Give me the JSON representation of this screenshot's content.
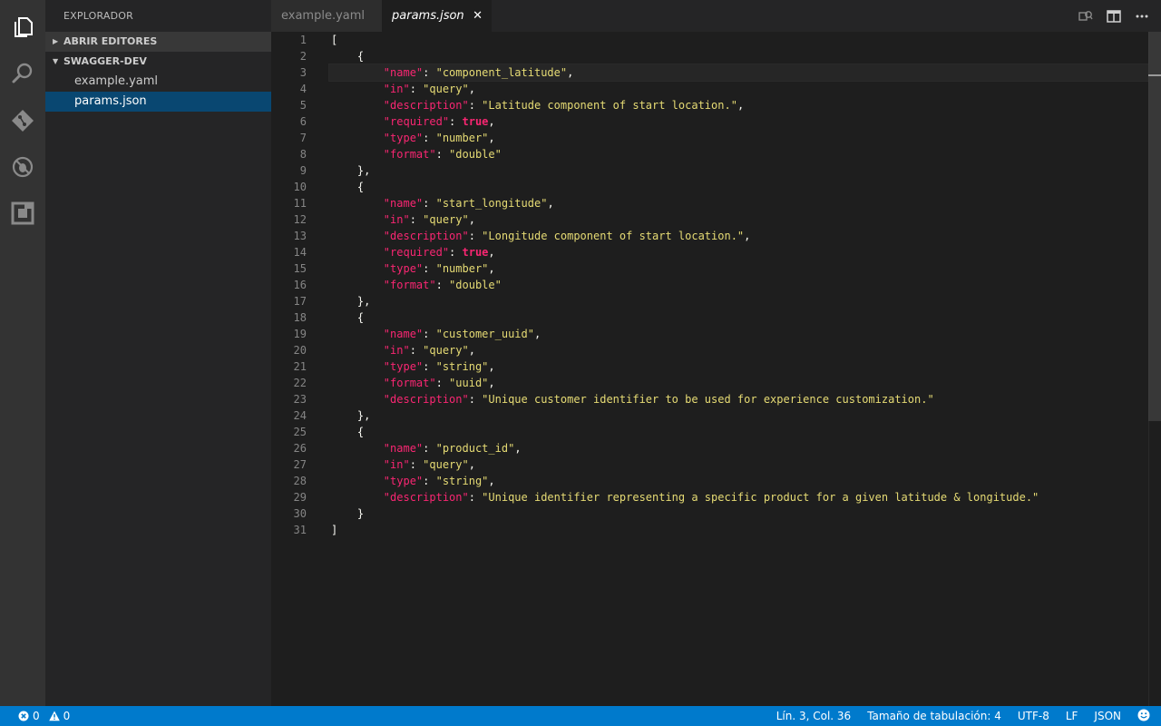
{
  "explorer": {
    "title": "EXPLORADOR",
    "open_editors": "ABRIR EDITORES",
    "project": "SWAGGER-DEV",
    "files": [
      "example.yaml",
      "params.json"
    ]
  },
  "tabs": [
    {
      "label": "example.yaml"
    },
    {
      "label": "params.json",
      "close": "✕"
    }
  ],
  "editor": {
    "line_numbers": [
      "1",
      "2",
      "3",
      "4",
      "5",
      "6",
      "7",
      "8",
      "9",
      "10",
      "11",
      "12",
      "13",
      "14",
      "15",
      "16",
      "17",
      "18",
      "19",
      "20",
      "21",
      "22",
      "23",
      "24",
      "25",
      "26",
      "27",
      "28",
      "29",
      "30",
      "31"
    ],
    "tokens": [
      [
        [
          "p",
          "["
        ]
      ],
      [
        [
          "p",
          "    {"
        ]
      ],
      [
        [
          "p",
          "        "
        ],
        [
          "k",
          "\"name\""
        ],
        [
          "p",
          ": "
        ],
        [
          "s",
          "\"component_latitude\""
        ],
        [
          "p",
          ","
        ]
      ],
      [
        [
          "p",
          "        "
        ],
        [
          "k",
          "\"in\""
        ],
        [
          "p",
          ": "
        ],
        [
          "s",
          "\"query\""
        ],
        [
          "p",
          ","
        ]
      ],
      [
        [
          "p",
          "        "
        ],
        [
          "k",
          "\"description\""
        ],
        [
          "p",
          ": "
        ],
        [
          "s",
          "\"Latitude component of start location.\""
        ],
        [
          "p",
          ","
        ]
      ],
      [
        [
          "p",
          "        "
        ],
        [
          "k",
          "\"required\""
        ],
        [
          "p",
          ": "
        ],
        [
          "b",
          "true"
        ],
        [
          "p",
          ","
        ]
      ],
      [
        [
          "p",
          "        "
        ],
        [
          "k",
          "\"type\""
        ],
        [
          "p",
          ": "
        ],
        [
          "s",
          "\"number\""
        ],
        [
          "p",
          ","
        ]
      ],
      [
        [
          "p",
          "        "
        ],
        [
          "k",
          "\"format\""
        ],
        [
          "p",
          ": "
        ],
        [
          "s",
          "\"double\""
        ]
      ],
      [
        [
          "p",
          "    },"
        ]
      ],
      [
        [
          "p",
          "    {"
        ]
      ],
      [
        [
          "p",
          "        "
        ],
        [
          "k",
          "\"name\""
        ],
        [
          "p",
          ": "
        ],
        [
          "s",
          "\"start_longitude\""
        ],
        [
          "p",
          ","
        ]
      ],
      [
        [
          "p",
          "        "
        ],
        [
          "k",
          "\"in\""
        ],
        [
          "p",
          ": "
        ],
        [
          "s",
          "\"query\""
        ],
        [
          "p",
          ","
        ]
      ],
      [
        [
          "p",
          "        "
        ],
        [
          "k",
          "\"description\""
        ],
        [
          "p",
          ": "
        ],
        [
          "s",
          "\"Longitude component of start location.\""
        ],
        [
          "p",
          ","
        ]
      ],
      [
        [
          "p",
          "        "
        ],
        [
          "k",
          "\"required\""
        ],
        [
          "p",
          ": "
        ],
        [
          "b",
          "true"
        ],
        [
          "p",
          ","
        ]
      ],
      [
        [
          "p",
          "        "
        ],
        [
          "k",
          "\"type\""
        ],
        [
          "p",
          ": "
        ],
        [
          "s",
          "\"number\""
        ],
        [
          "p",
          ","
        ]
      ],
      [
        [
          "p",
          "        "
        ],
        [
          "k",
          "\"format\""
        ],
        [
          "p",
          ": "
        ],
        [
          "s",
          "\"double\""
        ]
      ],
      [
        [
          "p",
          "    },"
        ]
      ],
      [
        [
          "p",
          "    {"
        ]
      ],
      [
        [
          "p",
          "        "
        ],
        [
          "k",
          "\"name\""
        ],
        [
          "p",
          ": "
        ],
        [
          "s",
          "\"customer_uuid\""
        ],
        [
          "p",
          ","
        ]
      ],
      [
        [
          "p",
          "        "
        ],
        [
          "k",
          "\"in\""
        ],
        [
          "p",
          ": "
        ],
        [
          "s",
          "\"query\""
        ],
        [
          "p",
          ","
        ]
      ],
      [
        [
          "p",
          "        "
        ],
        [
          "k",
          "\"type\""
        ],
        [
          "p",
          ": "
        ],
        [
          "s",
          "\"string\""
        ],
        [
          "p",
          ","
        ]
      ],
      [
        [
          "p",
          "        "
        ],
        [
          "k",
          "\"format\""
        ],
        [
          "p",
          ": "
        ],
        [
          "s",
          "\"uuid\""
        ],
        [
          "p",
          ","
        ]
      ],
      [
        [
          "p",
          "        "
        ],
        [
          "k",
          "\"description\""
        ],
        [
          "p",
          ": "
        ],
        [
          "s",
          "\"Unique customer identifier to be used for experience customization.\""
        ]
      ],
      [
        [
          "p",
          "    },"
        ]
      ],
      [
        [
          "p",
          "    {"
        ]
      ],
      [
        [
          "p",
          "        "
        ],
        [
          "k",
          "\"name\""
        ],
        [
          "p",
          ": "
        ],
        [
          "s",
          "\"product_id\""
        ],
        [
          "p",
          ","
        ]
      ],
      [
        [
          "p",
          "        "
        ],
        [
          "k",
          "\"in\""
        ],
        [
          "p",
          ": "
        ],
        [
          "s",
          "\"query\""
        ],
        [
          "p",
          ","
        ]
      ],
      [
        [
          "p",
          "        "
        ],
        [
          "k",
          "\"type\""
        ],
        [
          "p",
          ": "
        ],
        [
          "s",
          "\"string\""
        ],
        [
          "p",
          ","
        ]
      ],
      [
        [
          "p",
          "        "
        ],
        [
          "k",
          "\"description\""
        ],
        [
          "p",
          ": "
        ],
        [
          "s",
          "\"Unique identifier representing a specific product for a given latitude & longitude.\""
        ]
      ],
      [
        [
          "p",
          "    }"
        ]
      ],
      [
        [
          "p",
          "]"
        ]
      ]
    ]
  },
  "statusbar": {
    "errors": "0",
    "warnings": "0",
    "position": "Lín. 3, Col. 36",
    "tab_size": "Tamaño de tabulación: 4",
    "encoding": "UTF-8",
    "eol": "LF",
    "language": "JSON"
  },
  "colors": {
    "accent": "#007acc",
    "selection": "#094771",
    "key": "#f92672",
    "string": "#e6db74"
  },
  "icons": [
    "files-icon",
    "search-icon",
    "git-icon",
    "debug-icon",
    "extensions-icon",
    "compare-icon",
    "split-editor-icon",
    "error-icon",
    "warning-icon",
    "smiley-icon"
  ]
}
